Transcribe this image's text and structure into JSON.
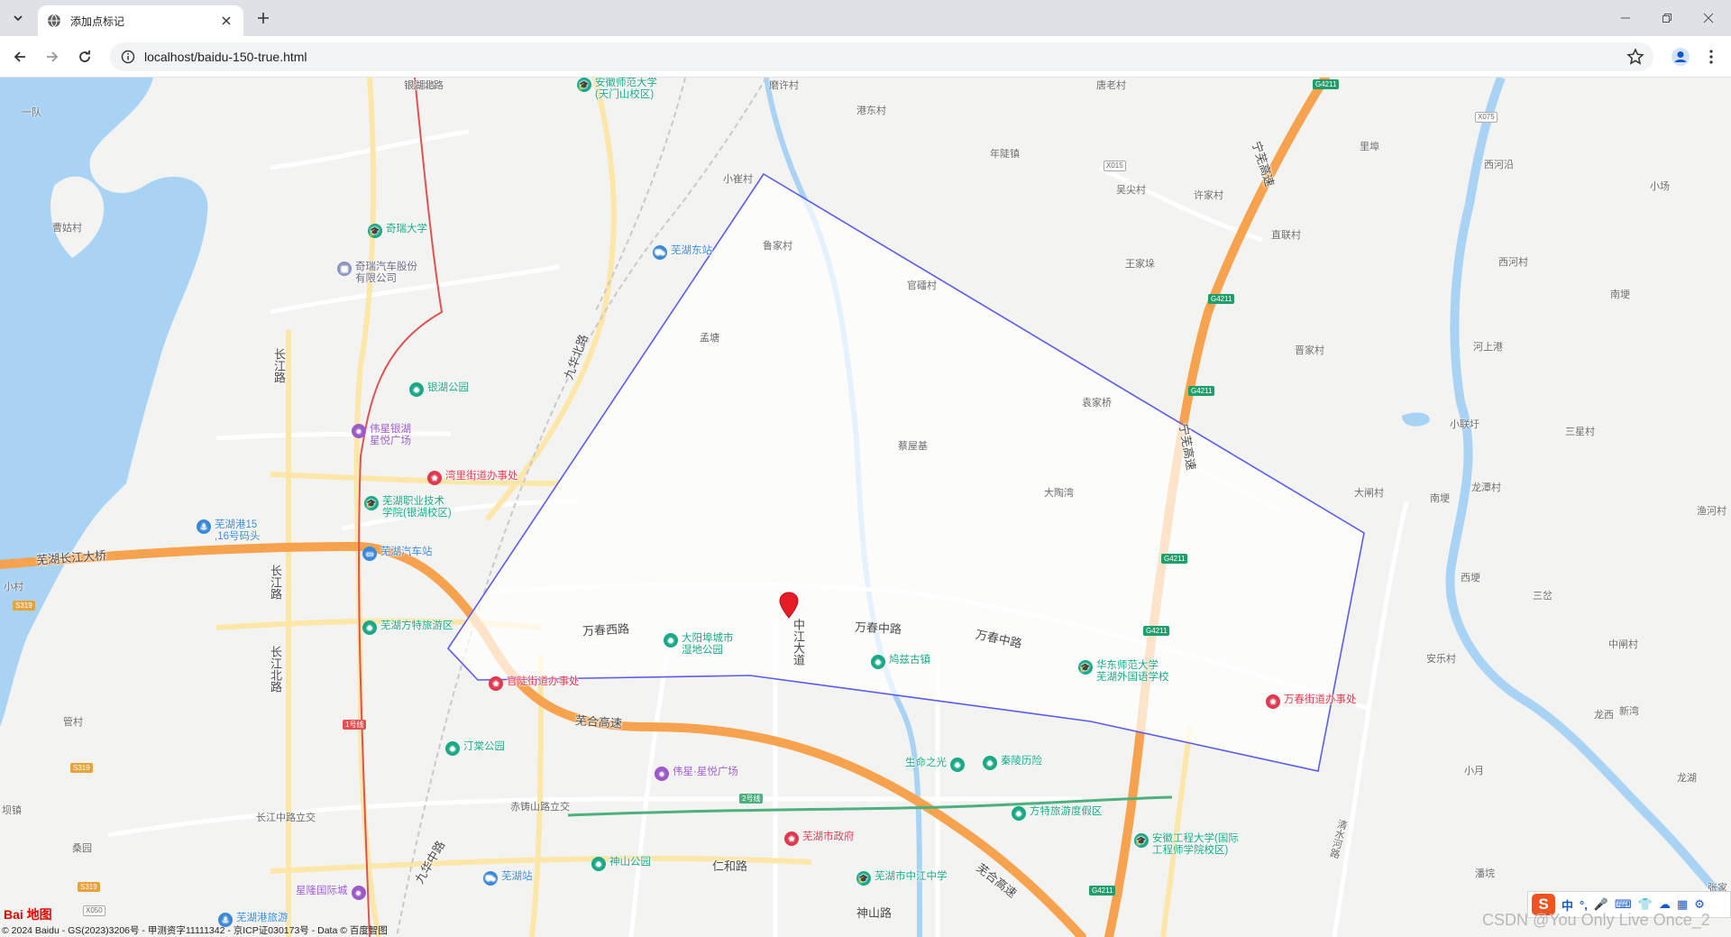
{
  "browser": {
    "tab_title": "添加点标记",
    "url": "localhost/baidu-150-true.html"
  },
  "map": {
    "places": [
      {
        "id": "p1",
        "text": "一队"
      },
      {
        "id": "p2",
        "text": "曹姑村"
      },
      {
        "id": "p3",
        "text": "鸣湖路"
      },
      {
        "id": "p4",
        "text": "小崔村"
      },
      {
        "id": "p5",
        "text": "港东村"
      },
      {
        "id": "p6",
        "text": "磨许村"
      },
      {
        "id": "p7",
        "text": "唐老村"
      },
      {
        "id": "p8",
        "text": "年陡镇"
      },
      {
        "id": "p9",
        "text": "里埠"
      },
      {
        "id": "p10",
        "text": "西河沿"
      },
      {
        "id": "p11",
        "text": "小场"
      },
      {
        "id": "p12",
        "text": "吴尖村"
      },
      {
        "id": "p13",
        "text": "许家村"
      },
      {
        "id": "p14",
        "text": "鲁家村"
      },
      {
        "id": "p15",
        "text": "官礌村"
      },
      {
        "id": "p16",
        "text": "王家垛"
      },
      {
        "id": "p17",
        "text": "直联村"
      },
      {
        "id": "p18",
        "text": "西河村"
      },
      {
        "id": "p19",
        "text": "南埂"
      },
      {
        "id": "p20",
        "text": "孟塘"
      },
      {
        "id": "p21",
        "text": "晋家村"
      },
      {
        "id": "p22",
        "text": "河上港"
      },
      {
        "id": "p23",
        "text": "袁家桥"
      },
      {
        "id": "p24",
        "text": "小联圩"
      },
      {
        "id": "p25",
        "text": "三星村"
      },
      {
        "id": "p26",
        "text": "蔡屋基"
      },
      {
        "id": "p27",
        "text": "大陶湾"
      },
      {
        "id": "p28",
        "text": "大闸村"
      },
      {
        "id": "p29",
        "text": "南埂"
      },
      {
        "id": "p30",
        "text": "龙潭村"
      },
      {
        "id": "p31",
        "text": "渔河村"
      },
      {
        "id": "p32",
        "text": "西埂"
      },
      {
        "id": "p33",
        "text": "三岔"
      },
      {
        "id": "p34",
        "text": "中闸村"
      },
      {
        "id": "p35",
        "text": "安乐村"
      },
      {
        "id": "p36",
        "text": "新湾"
      },
      {
        "id": "p37",
        "text": "龙西"
      },
      {
        "id": "p38",
        "text": "小月"
      },
      {
        "id": "p39",
        "text": "龙湖"
      },
      {
        "id": "p40",
        "text": "小村"
      },
      {
        "id": "p41",
        "text": "管村"
      },
      {
        "id": "p42",
        "text": "坝镇"
      },
      {
        "id": "p43",
        "text": "桑园"
      },
      {
        "id": "p44",
        "text": "潘垸"
      },
      {
        "id": "p45",
        "text": "张家"
      }
    ],
    "roads": [
      {
        "id": "r1",
        "text": "芜湖长江大桥"
      },
      {
        "id": "r2",
        "text": "九华北路"
      },
      {
        "id": "r3",
        "text": "长江路"
      },
      {
        "id": "r4",
        "text": "长江路"
      },
      {
        "id": "r5",
        "text": "长江北路"
      },
      {
        "id": "r6",
        "text": "万春西路"
      },
      {
        "id": "r7",
        "text": "中江大道"
      },
      {
        "id": "r8",
        "text": "万春中路"
      },
      {
        "id": "r9",
        "text": "万春中路"
      },
      {
        "id": "r10",
        "text": "宁芜高速"
      },
      {
        "id": "r11",
        "text": "宁芜高速"
      },
      {
        "id": "r12",
        "text": "芜合高速"
      },
      {
        "id": "r13",
        "text": "芜合高速"
      },
      {
        "id": "r14",
        "text": "长江中路立交"
      },
      {
        "id": "r15",
        "text": "赤铸山路立交"
      },
      {
        "id": "r16",
        "text": "仁和路"
      },
      {
        "id": "r17",
        "text": "神山路"
      },
      {
        "id": "r18",
        "text": "九华中路"
      },
      {
        "id": "r19",
        "text": "清水河路"
      },
      {
        "id": "r20",
        "text": "银湖北路"
      }
    ],
    "pois": [
      {
        "id": "q1",
        "text": "安徽师范大学\n(天门山校区)",
        "color": "#1aa886",
        "icon": "graduation-icon"
      },
      {
        "id": "q2",
        "text": "奇瑞大学",
        "color": "#1aa886",
        "icon": "graduation-icon"
      },
      {
        "id": "q3",
        "text": "奇瑞汽车股份\n有限公司",
        "color": "#6a78b0",
        "icon": "company-icon"
      },
      {
        "id": "q4",
        "text": "芜湖东站",
        "color": "#3a88d8",
        "icon": "train-icon"
      },
      {
        "id": "q5",
        "text": "银湖公园",
        "color": "#1aa886",
        "icon": "park-icon"
      },
      {
        "id": "q6",
        "text": "伟星银湖\n星悦广场",
        "color": "#9b59c9",
        "icon": "shopping-icon"
      },
      {
        "id": "q7",
        "text": "湾里街道办事处",
        "color": "#e0384f",
        "icon": "government-icon"
      },
      {
        "id": "q8",
        "text": "芜湖职业技术\n学院(银湖校区)",
        "color": "#1aa886",
        "icon": "graduation-icon"
      },
      {
        "id": "q9",
        "text": "芜湖港15\n,16号码头",
        "color": "#3a88d8",
        "icon": "anchor-icon"
      },
      {
        "id": "q10",
        "text": "芜湖汽车站",
        "color": "#3a88d8",
        "icon": "bus-icon"
      },
      {
        "id": "q11",
        "text": "芜湖方特旅游区",
        "color": "#1aa886",
        "icon": "park-icon"
      },
      {
        "id": "q12",
        "text": "大阳埠城市\n湿地公园",
        "color": "#1aa886",
        "icon": "park-icon"
      },
      {
        "id": "q13",
        "text": "鸠兹古镇",
        "color": "#1aa886",
        "icon": "park-icon"
      },
      {
        "id": "q14",
        "text": "华东师范大学\n芜湖外国语学校",
        "color": "#1aa886",
        "icon": "graduation-icon"
      },
      {
        "id": "q15",
        "text": "官陡街道办事处",
        "color": "#e0384f",
        "icon": "government-icon"
      },
      {
        "id": "q16",
        "text": "万春街道办事处",
        "color": "#e0384f",
        "icon": "government-icon"
      },
      {
        "id": "q17",
        "text": "汀棠公园",
        "color": "#1aa886",
        "icon": "park-icon"
      },
      {
        "id": "q18",
        "text": "伟星·星悦广场",
        "color": "#9b59c9",
        "icon": "shopping-icon"
      },
      {
        "id": "q19",
        "text": "生命之光",
        "color": "#1aa886",
        "icon": "park-icon"
      },
      {
        "id": "q20",
        "text": "秦陵历险",
        "color": "#1aa886",
        "icon": "park-icon"
      },
      {
        "id": "q21",
        "text": "方特旅游度假区",
        "color": "#1aa886",
        "icon": "park-icon"
      },
      {
        "id": "q22",
        "text": "安徽工程大学(国际\n工程师学院校区)",
        "color": "#1aa886",
        "icon": "graduation-icon"
      },
      {
        "id": "q23",
        "text": "芜湖市政府",
        "color": "#e0384f",
        "icon": "government-icon"
      },
      {
        "id": "q24",
        "text": "神山公园",
        "color": "#1aa886",
        "icon": "park-icon"
      },
      {
        "id": "q25",
        "text": "芜湖站",
        "color": "#3a88d8",
        "icon": "train-icon"
      },
      {
        "id": "q26",
        "text": "芜湖市中江中学",
        "color": "#1aa886",
        "icon": "graduation-icon"
      },
      {
        "id": "q27",
        "text": "星隆国际城",
        "color": "#9b59c9",
        "icon": "shopping-icon"
      },
      {
        "id": "q28",
        "text": "芜湖港旅游",
        "color": "#3a88d8",
        "icon": "anchor-icon"
      }
    ],
    "shields": [
      {
        "id": "s1",
        "text": "G4211"
      },
      {
        "id": "s2",
        "text": "G4211"
      },
      {
        "id": "s3",
        "text": "G4211"
      },
      {
        "id": "s4",
        "text": "G4211"
      },
      {
        "id": "s5",
        "text": "G4211"
      },
      {
        "id": "s6",
        "text": "G4211"
      },
      {
        "id": "s7",
        "text": "X075"
      },
      {
        "id": "s8",
        "text": "X015"
      },
      {
        "id": "s9",
        "text": "S319"
      },
      {
        "id": "s10",
        "text": "S319"
      },
      {
        "id": "s11",
        "text": "S319"
      },
      {
        "id": "s12",
        "text": "X050"
      },
      {
        "id": "s13",
        "text": "1号线"
      },
      {
        "id": "s14",
        "text": "2号线"
      }
    ],
    "marker": {
      "color": "#e81c24"
    },
    "polygon": {
      "stroke": "#5b5bf0",
      "fill": "#ffffff"
    },
    "water_color": "#a9d3f5",
    "highway_color": "#f6a24e"
  },
  "ime_toolbar": {
    "logo": "S",
    "items": [
      "中",
      "°,",
      "🎤",
      "⌨",
      "👕",
      "☁",
      "▦",
      "⚙"
    ]
  },
  "footer": {
    "logo_text": "Bai 地图",
    "copyright": "© 2024 Baidu - GS(2023)3206号 - 甲测资字11111342 - 京ICP证030173号 - Data © 百度智图",
    "watermark": "CSDN @You Only Live Once_2"
  }
}
